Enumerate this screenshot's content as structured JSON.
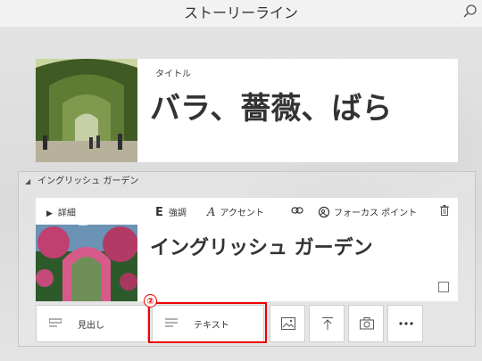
{
  "app": {
    "title": "ストーリーライン"
  },
  "title_card": {
    "label": "タイトル",
    "title": "バラ、薔薇、ばら"
  },
  "section": {
    "name": "イングリッシュ ガーデン",
    "card": {
      "details_label": "詳細",
      "toolbar": {
        "emphasis_glyph": "E",
        "emphasis": "強調",
        "accent_glyph": "A",
        "accent": "アクセント",
        "focus": "フォーカス ポイント"
      },
      "heading": "イングリッシュ ガーデン"
    }
  },
  "add_bar": {
    "heading_label": "見出し",
    "text_label": "テキスト",
    "icons": [
      "image-icon",
      "upload-icon",
      "camera-icon",
      "more-icon"
    ]
  },
  "annotation": {
    "callout": "②",
    "color": "#e00000"
  }
}
